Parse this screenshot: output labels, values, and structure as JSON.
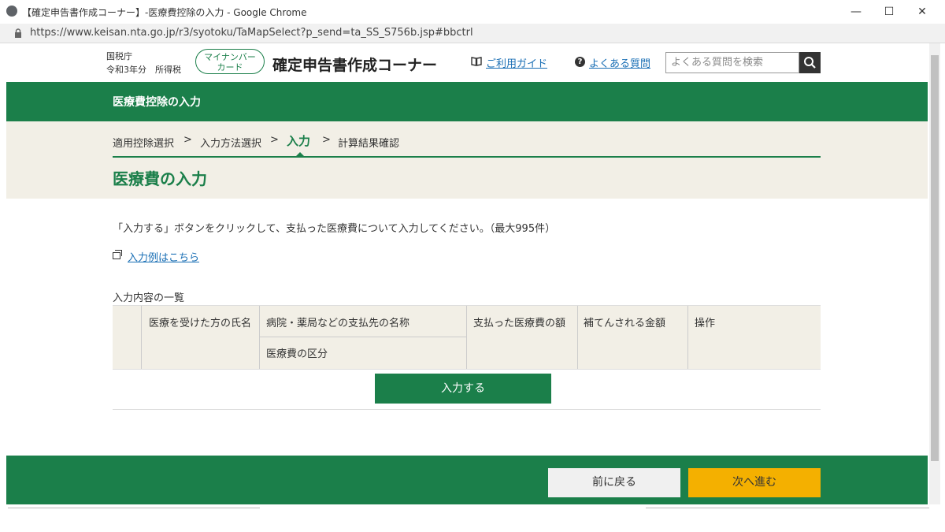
{
  "window": {
    "title": "【確定申告書作成コーナー】-医療費控除の入力 - Google Chrome",
    "url": "https://www.keisan.nta.go.jp/r3/syotoku/TaMapSelect?p_send=ta_SS_S756b.jsp#bbctrl",
    "minimize": "—",
    "maximize": "☐",
    "close": "✕"
  },
  "header": {
    "agency": "国税庁",
    "year": "令和3年分　所得税",
    "mynumber_line1": "マイナンバー",
    "mynumber_line2": "カード",
    "site_title": "確定申告書作成コーナー",
    "guide_icon": "book-icon",
    "guide_label": "ご利用ガイド",
    "faq_icon": "?",
    "faq_label": "よくある質問",
    "search_placeholder": "よくある質問を検索"
  },
  "banner": {
    "title": "医療費控除の入力"
  },
  "steps": {
    "items": [
      "適用控除選択",
      "入力方法選択",
      "入力",
      "計算結果確認"
    ],
    "separator": ">"
  },
  "section_title": "医療費の入力",
  "instruction": "「入力する」ボタンをクリックして、支払った医療費について入力してください。（最大995件）",
  "example_link": "入力例はこちら",
  "list_label": "入力内容の一覧",
  "table": {
    "headers": {
      "patient": "医療を受けた方の氏名",
      "payee": "病院・薬局などの支払先の名称",
      "category": "医療費の区分",
      "amount": "支払った医療費の額",
      "reimbursed": "補てんされる金額",
      "operation": "操作"
    }
  },
  "add_button": "入力する",
  "footer": {
    "back": "前に戻る",
    "next": "次へ進む"
  },
  "colors": {
    "brand_green": "#1b7f4a",
    "next_yellow": "#f4b000",
    "link_blue": "#1a6fb5"
  }
}
